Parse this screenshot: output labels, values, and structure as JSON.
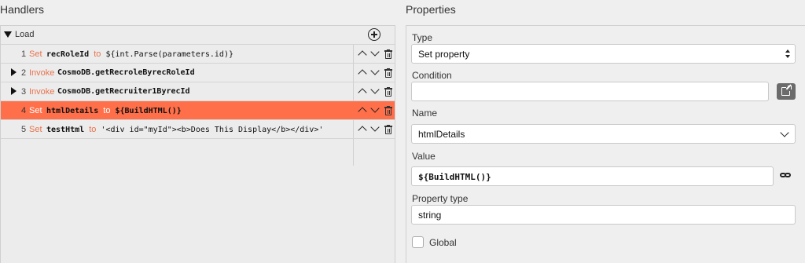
{
  "headings": {
    "handlers": "Handlers",
    "properties": "Properties"
  },
  "handlers": {
    "group_label": "Load",
    "steps": [
      {
        "num": "1",
        "keyword": "Set",
        "target": "recRoleId",
        "to": "to",
        "value": "${int.Parse(parameters.id)}"
      },
      {
        "num": "2",
        "keyword": "Invoke",
        "target": "CosmoDB.getRecroleByrecRoleId"
      },
      {
        "num": "3",
        "keyword": "Invoke",
        "target": "CosmoDB.getRecruiter1ByrecId"
      },
      {
        "num": "4",
        "keyword": "Set",
        "target": "htmlDetails",
        "to": "to",
        "value": "${BuildHTML()}"
      },
      {
        "num": "5",
        "keyword": "Set",
        "target": "testHtml",
        "to": "to",
        "value": "'<div id=\"myId\"><b>Does This Display</b></div>'"
      }
    ]
  },
  "properties": {
    "type_label": "Type",
    "type_value": "Set property",
    "condition_label": "Condition",
    "condition_value": "",
    "name_label": "Name",
    "name_value": "htmlDetails",
    "value_label": "Value",
    "value_value": "${BuildHTML()}",
    "property_type_label": "Property type",
    "property_type_value": "string",
    "global_label": "Global",
    "global_checked": false
  },
  "colors": {
    "selected_row": "#ff6f4a",
    "keyword": "#e8734e",
    "popout_button": "#6b6b6b"
  }
}
